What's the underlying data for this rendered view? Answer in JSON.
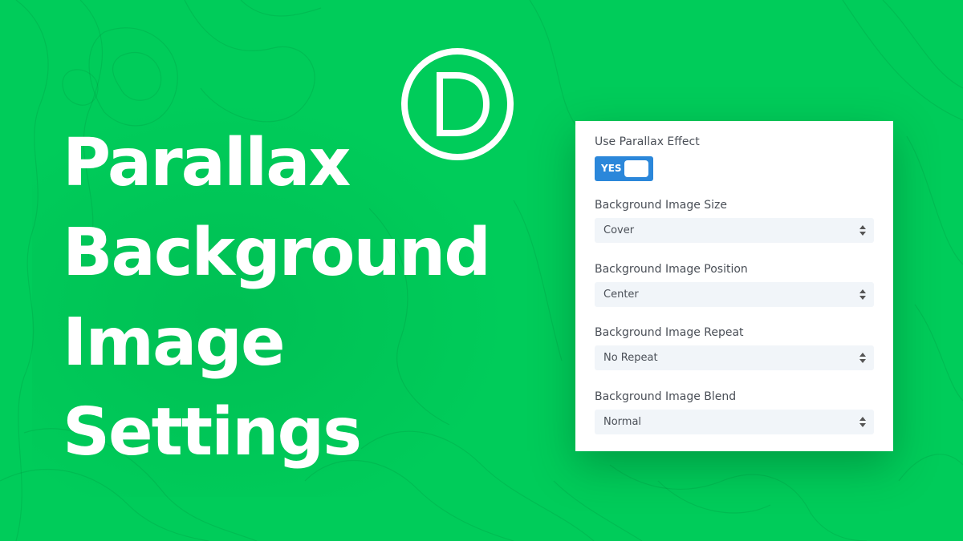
{
  "headline": {
    "lines": [
      "Parallax",
      "Background",
      "Image",
      "Settings"
    ]
  },
  "logo": {
    "icon": "divi-logo-icon",
    "letter": "D"
  },
  "settings_panel": {
    "parallax": {
      "label": "Use Parallax Effect",
      "toggle_label": "YES",
      "enabled": true
    },
    "fields": [
      {
        "label": "Background Image Size",
        "value": "Cover"
      },
      {
        "label": "Background Image Position",
        "value": "Center"
      },
      {
        "label": "Background Image Repeat",
        "value": "No Repeat"
      },
      {
        "label": "Background Image Blend",
        "value": "Normal"
      }
    ]
  },
  "colors": {
    "background": "#00cc5a",
    "toggle": "#2b87da",
    "select_bg": "#f1f5f9",
    "text": "#4a4f57"
  }
}
